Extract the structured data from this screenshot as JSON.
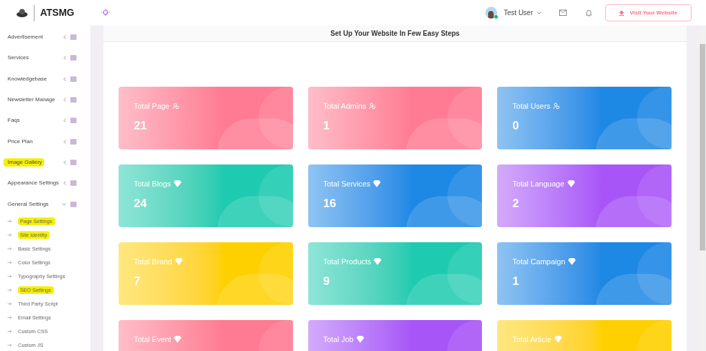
{
  "header": {
    "brand": "ATSMG",
    "user": {
      "name": "Test User",
      "online": true
    },
    "visit_button": "Visit Your Website"
  },
  "sidebar": {
    "items": [
      {
        "label": "Advertisement",
        "expanded": false,
        "highlighted": false
      },
      {
        "label": "Services",
        "expanded": false,
        "highlighted": false
      },
      {
        "label": "Knowledgebase",
        "expanded": false,
        "highlighted": false
      },
      {
        "label": "Newsletter Manage",
        "expanded": false,
        "highlighted": false
      },
      {
        "label": "Faqs",
        "expanded": false,
        "highlighted": false
      },
      {
        "label": "Price Plan",
        "expanded": false,
        "highlighted": false
      },
      {
        "label": "Image Gallery",
        "expanded": false,
        "highlighted": true
      },
      {
        "label": "Appearance Settings",
        "expanded": false,
        "highlighted": false
      },
      {
        "label": "General Settings",
        "expanded": true,
        "highlighted": false,
        "children": [
          {
            "label": "Page Settings",
            "highlighted": true
          },
          {
            "label": "Site Identity",
            "highlighted": true
          },
          {
            "label": "Basic Settings",
            "highlighted": false
          },
          {
            "label": "Color Settings",
            "highlighted": false
          },
          {
            "label": "Typography Settings",
            "highlighted": false
          },
          {
            "label": "SEO Settings",
            "highlighted": true
          },
          {
            "label": "Third Party Script",
            "highlighted": false
          },
          {
            "label": "Email Settings",
            "highlighted": false
          },
          {
            "label": "Custom CSS",
            "highlighted": false
          },
          {
            "label": "Custom JS",
            "highlighted": false
          }
        ]
      }
    ]
  },
  "main": {
    "title": "Set Up Your Website In Few Easy Steps",
    "cards": [
      {
        "label": "Total Page",
        "value": "21",
        "kind": "people",
        "color": "#ff7b93"
      },
      {
        "label": "Total Admins",
        "value": "1",
        "kind": "people",
        "color": "#ff7b93"
      },
      {
        "label": "Total Users",
        "value": "0",
        "kind": "people",
        "color": "#1e88e5"
      },
      {
        "label": "Total Blogs",
        "value": "24",
        "kind": "diamond",
        "color": "#1ecbb0"
      },
      {
        "label": "Total Services",
        "value": "16",
        "kind": "diamond",
        "color": "#1e88e5"
      },
      {
        "label": "Total Language",
        "value": "2",
        "kind": "diamond",
        "color": "#a855f7"
      },
      {
        "label": "Total Brand",
        "value": "7",
        "kind": "diamond",
        "color": "#ffd000"
      },
      {
        "label": "Total Products",
        "value": "9",
        "kind": "diamond",
        "color": "#1ecbb0"
      },
      {
        "label": "Total Campaign",
        "value": "1",
        "kind": "diamond",
        "color": "#1e88e5"
      },
      {
        "label": "Total Event",
        "kind": "diamond",
        "color": "#ff7b93"
      },
      {
        "label": "Total Job",
        "kind": "diamond",
        "color": "#a855f7"
      },
      {
        "label": "Total Article",
        "kind": "diamond",
        "color": "#ffd000"
      }
    ]
  }
}
